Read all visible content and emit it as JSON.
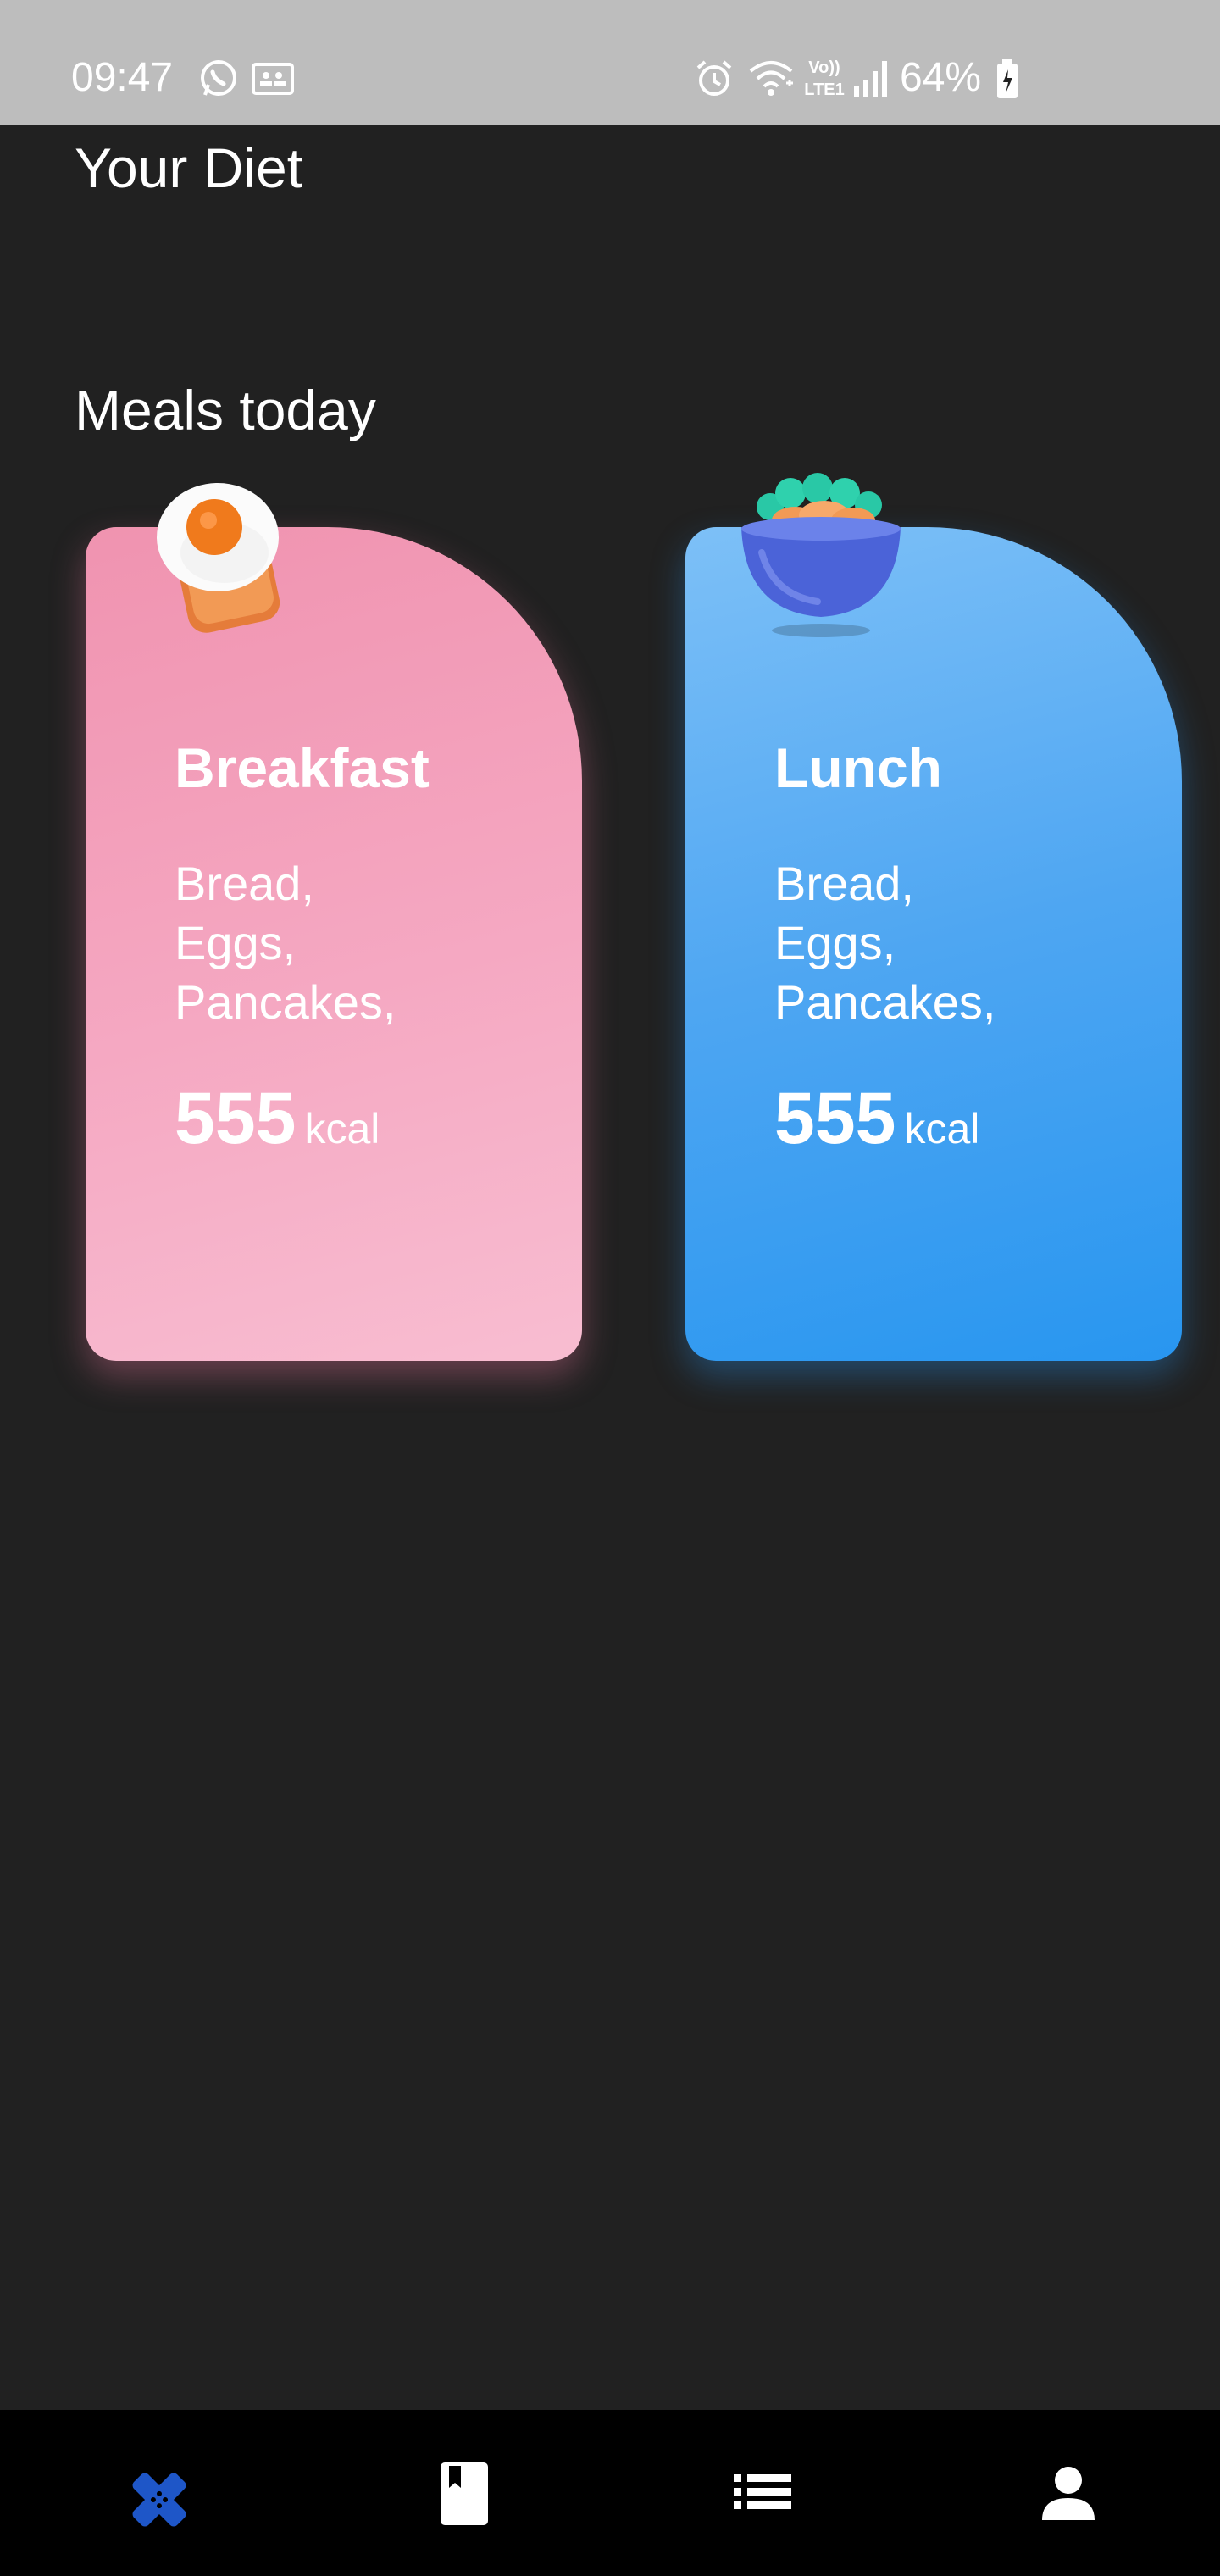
{
  "status_bar": {
    "time": "09:47",
    "battery_percent": "64%",
    "battery_level": 0.64,
    "icons": [
      "whatsapp-icon",
      "gallery-icon",
      "alarm-icon",
      "wifi-icon",
      "volte-icon",
      "signal-icon",
      "battery-icon"
    ]
  },
  "page": {
    "title": "Your Diet",
    "section_title": "Meals today"
  },
  "meals": [
    {
      "name": "Breakfast",
      "items": [
        "Bread,",
        "Eggs,",
        "Pancakes,"
      ],
      "kcal_value": "555",
      "kcal_unit": "kcal",
      "icon": "fried-egg-toast-icon",
      "colors": [
        "#f093b0",
        "#f8bdd1"
      ]
    },
    {
      "name": "Lunch",
      "items": [
        "Bread,",
        "Eggs,",
        "Pancakes,"
      ],
      "kcal_value": "555",
      "kcal_unit": "kcal",
      "icon": "salad-bowl-icon",
      "colors": [
        "#7dc0f7",
        "#2896f0"
      ]
    }
  ],
  "bottom_nav": {
    "items": [
      {
        "icon": "health-bandage-icon",
        "active": true,
        "color": "#1e56c8"
      },
      {
        "icon": "bookmark-book-icon",
        "active": false,
        "color": "#ffffff"
      },
      {
        "icon": "list-icon",
        "active": false,
        "color": "#ffffff"
      },
      {
        "icon": "person-icon",
        "active": false,
        "color": "#ffffff"
      }
    ]
  }
}
